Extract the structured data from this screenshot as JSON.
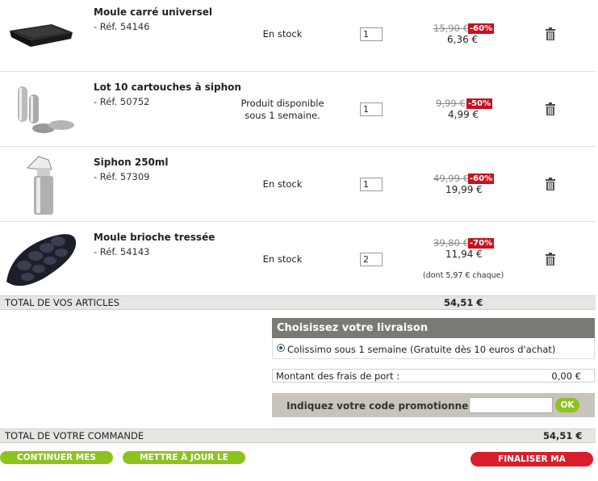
{
  "items": [
    {
      "name": "Moule carré universel",
      "ref": "- Réf. 54146",
      "availability_1": "En stock",
      "availability_2": "",
      "qty": "1",
      "old_price": "15,90 €",
      "discount": "-60%",
      "price": "6,36 €",
      "unit_note": ""
    },
    {
      "name": "Lot 10 cartouches à siphon",
      "ref": "- Réf. 50752",
      "availability_1": "Produit disponible",
      "availability_2": "sous 1 semaine.",
      "qty": "1",
      "old_price": "9,99 €",
      "discount": "-50%",
      "price": "4,99 €",
      "unit_note": ""
    },
    {
      "name": "Siphon 250ml",
      "ref": "- Réf. 57309",
      "availability_1": "En stock",
      "availability_2": "",
      "qty": "1",
      "old_price": "49,99 €",
      "discount": "-60%",
      "price": "19,99 €",
      "unit_note": ""
    },
    {
      "name": "Moule brioche tressée",
      "ref": "- Réf. 54143",
      "availability_1": "En stock",
      "availability_2": "",
      "qty": "2",
      "old_price": "39,80 €",
      "discount": "-70%",
      "price": "11,94 €",
      "unit_note": "(dont 5,97 € chaque)"
    }
  ],
  "totals": {
    "articles_label": "TOTAL DE VOS ARTICLES",
    "articles_value": "54,51 €",
    "order_label": "TOTAL DE VOTRE COMMANDE",
    "order_value": "54,51 €"
  },
  "shipping": {
    "title": "Choisissez votre livraison",
    "option": "Colissimo sous 1 semaine (Gratuite dès 10 euros d'achat)",
    "fees_label": "Montant des frais de port :",
    "fees_value": "0,00 €"
  },
  "promo": {
    "label": "Indiquez votre code promotionnel* ici :",
    "value": "",
    "ok": "OK"
  },
  "buttons": {
    "continue": "CONTINUER MES ACHATS",
    "update": "METTRE À JOUR LE PANIER",
    "finalize": "FINALISER MA COMMANDE"
  },
  "icons": {
    "trash": "trash-icon",
    "radio": "radio-selected-icon"
  },
  "colors": {
    "discount": "#c8101e",
    "green_button": "#8dc21f",
    "red_button": "#d81e2c",
    "shipping_header": "#7a7a74"
  }
}
